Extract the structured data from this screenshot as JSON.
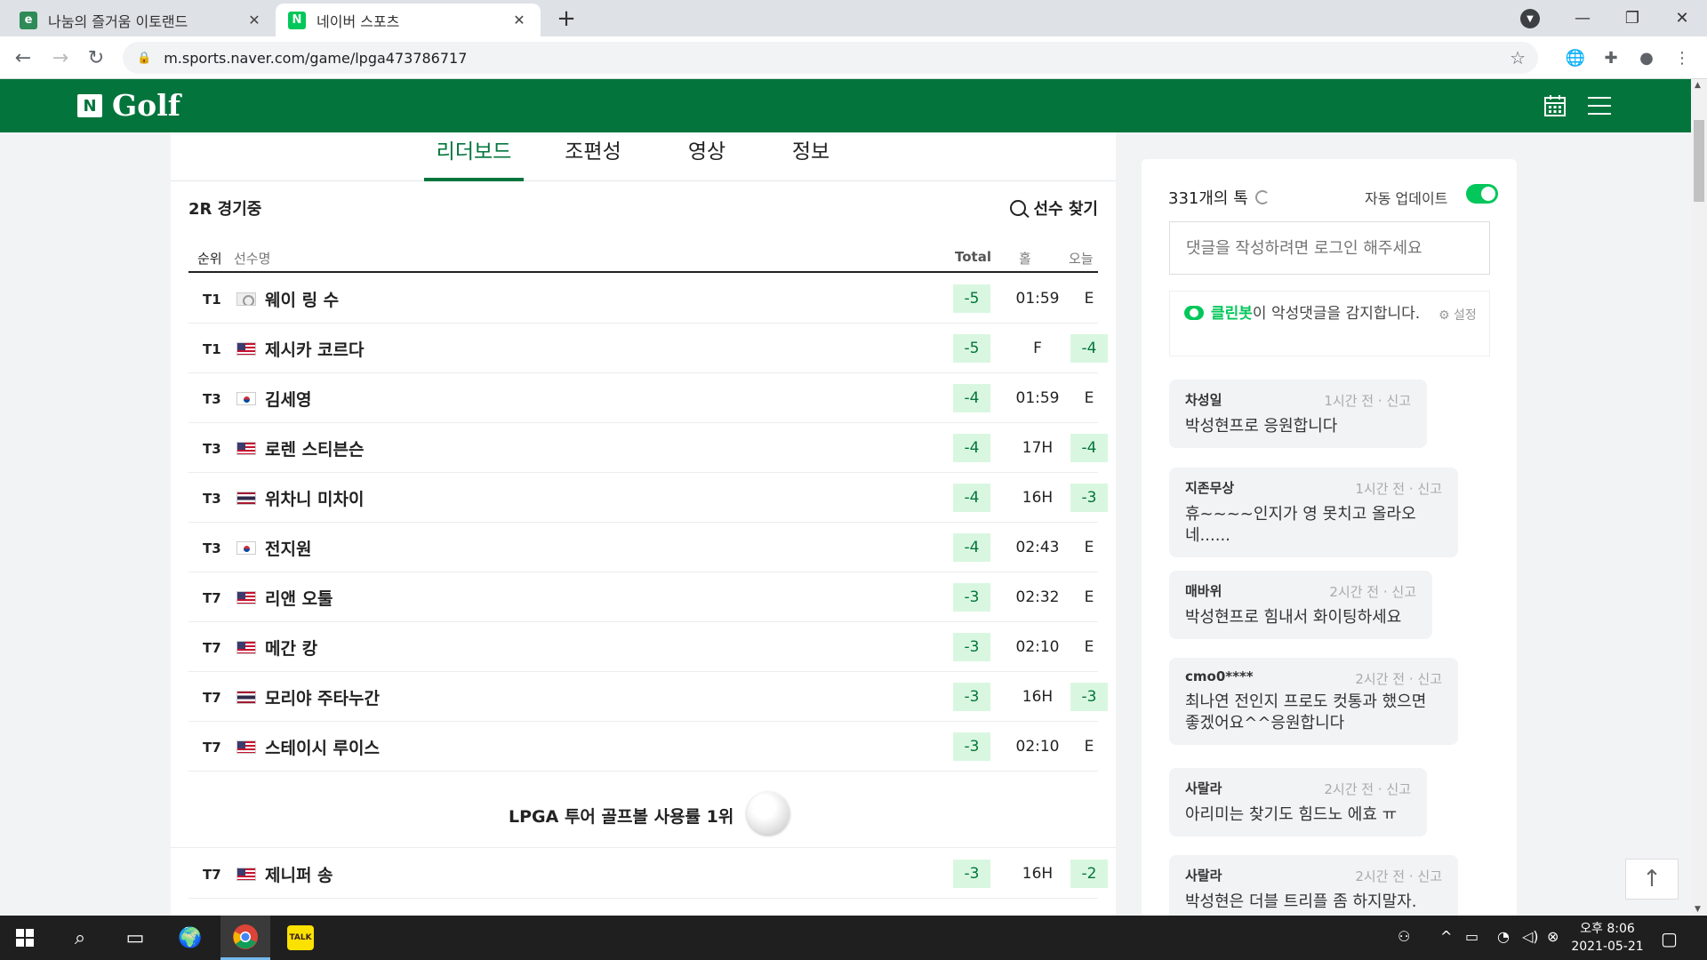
{
  "browser": {
    "tabs": [
      {
        "title": "나눔의 즐거움 이토랜드",
        "favicon": "e",
        "favicon_color": "#2e8b57"
      },
      {
        "title": "네이버 스포츠",
        "favicon": "N",
        "favicon_color": "#03c75a"
      }
    ],
    "url": "m.sports.naver.com/game/lpga473786717"
  },
  "header": {
    "logo_n": "N",
    "logo_text": "Golf"
  },
  "game_tabs": [
    "리더보드",
    "조편성",
    "영상",
    "정보"
  ],
  "leaderboard": {
    "round_status": "2R 경기중",
    "player_search": "선수 찾기",
    "columns": {
      "rank": "순위",
      "name": "선수명",
      "total": "Total",
      "hole": "홀",
      "today": "오늘"
    },
    "rows": [
      {
        "rank": "T1",
        "flag": "tw",
        "name": "웨이 링 수",
        "total": "-5",
        "hole": "01:59",
        "today": "E"
      },
      {
        "rank": "T1",
        "flag": "us",
        "name": "제시카 코르다",
        "total": "-5",
        "hole": "F",
        "today": "-4"
      },
      {
        "rank": "T3",
        "flag": "kr",
        "name": "김세영",
        "total": "-4",
        "hole": "01:59",
        "today": "E"
      },
      {
        "rank": "T3",
        "flag": "us",
        "name": "로렌 스티븐슨",
        "total": "-4",
        "hole": "17H",
        "today": "-4"
      },
      {
        "rank": "T3",
        "flag": "th",
        "name": "위차니 미차이",
        "total": "-4",
        "hole": "16H",
        "today": "-3"
      },
      {
        "rank": "T3",
        "flag": "kr",
        "name": "전지원",
        "total": "-4",
        "hole": "02:43",
        "today": "E"
      },
      {
        "rank": "T7",
        "flag": "us",
        "name": "리앤 오툴",
        "total": "-3",
        "hole": "02:32",
        "today": "E"
      },
      {
        "rank": "T7",
        "flag": "us",
        "name": "메간 캉",
        "total": "-3",
        "hole": "02:10",
        "today": "E"
      },
      {
        "rank": "T7",
        "flag": "th",
        "name": "모리야 주타누간",
        "total": "-3",
        "hole": "16H",
        "today": "-3"
      },
      {
        "rank": "T7",
        "flag": "us",
        "name": "스테이시 루이스",
        "total": "-3",
        "hole": "02:10",
        "today": "E"
      }
    ],
    "ad_text": "LPGA 투어 골프볼 사용률 1위",
    "rows_after_ad": [
      {
        "rank": "T7",
        "flag": "us",
        "name": "제니퍼 송",
        "total": "-3",
        "hole": "16H",
        "today": "-2"
      }
    ]
  },
  "talk": {
    "count_label": "331개의 톡",
    "auto_update_label": "자동 업데이트",
    "comment_placeholder": "댓글을 작성하려면 로그인 해주세요",
    "cleanbot_brand": "클린봇",
    "cleanbot_text": "이 악성댓글을 감지합니다.",
    "cleanbot_setting": "설정",
    "comments": [
      {
        "nick": "차성일",
        "meta": "1시간 전 · 신고",
        "text": "박성현프로 응원합니다"
      },
      {
        "nick": "지존무상",
        "meta": "1시간 전 · 신고",
        "text": "휴~~~~인지가 영 못치고 올라오네......"
      },
      {
        "nick": "매바위",
        "meta": "2시간 전 · 신고",
        "text": "박성현프로 힘내서 화이팅하세요"
      },
      {
        "nick": "cmo0****",
        "meta": "2시간 전 · 신고",
        "text": "최나연 전인지 프로도 컷통과 했으면 좋겠어요^^응원합니다"
      },
      {
        "nick": "사랄라",
        "meta": "2시간 전 · 신고",
        "text": "아리미는 찾기도 힘드노 에효 ㅠ"
      },
      {
        "nick": "사랄라",
        "meta": "2시간 전 · 신고",
        "text": "박성현은 더블 트리플 좀 하지말자."
      }
    ]
  },
  "taskbar": {
    "clock_time": "오후 8:06",
    "clock_date": "2021-05-21"
  },
  "colors": {
    "naver_green": "#03753c",
    "accent_green": "#03c75a",
    "score_bg": "#d9f7e0"
  }
}
